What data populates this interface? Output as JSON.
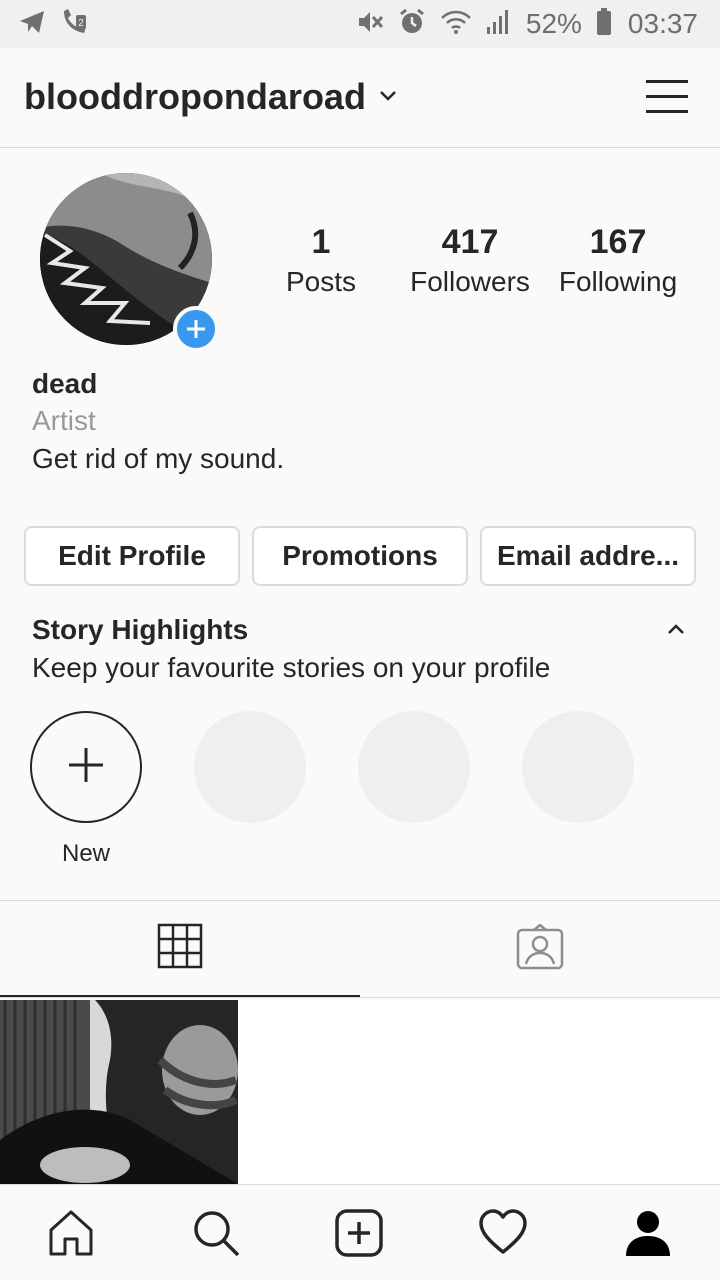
{
  "status_bar": {
    "battery": "52%",
    "time": "03:37",
    "icons": [
      "telegram-icon",
      "call-forward-icon",
      "mute-icon",
      "alarm-icon",
      "wifi-icon",
      "signal-icon",
      "battery-icon"
    ]
  },
  "header": {
    "username": "blooddropondaroad"
  },
  "profile": {
    "stats": [
      {
        "count": "1",
        "label": "Posts"
      },
      {
        "count": "417",
        "label": "Followers"
      },
      {
        "count": "167",
        "label": "Following"
      }
    ],
    "name": "dead",
    "category": "Artist",
    "bio": "Get rid of my sound."
  },
  "buttons": {
    "edit_profile": "Edit Profile",
    "promotions": "Promotions",
    "email": "Email addre..."
  },
  "highlights": {
    "title": "Story Highlights",
    "subtitle": "Keep your favourite stories on your profile",
    "new_label": "New"
  },
  "colors": {
    "accent": "#3897f0",
    "text": "#262626",
    "muted": "#999999",
    "border": "#dbdbdb",
    "background": "#fafafa"
  }
}
